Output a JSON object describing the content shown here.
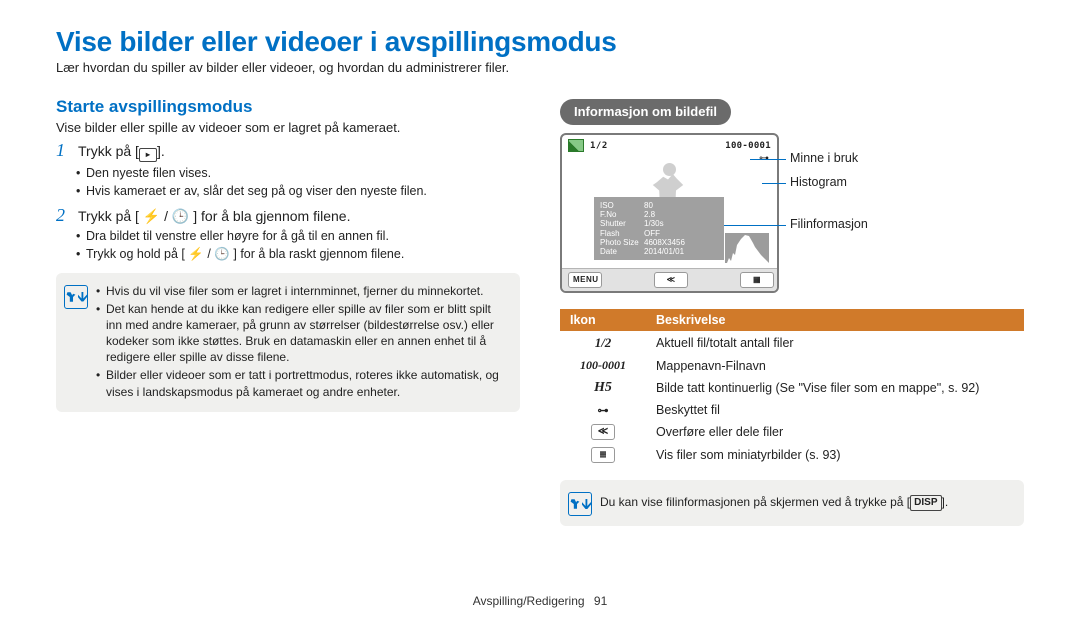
{
  "page_title": "Vise bilder eller videoer i avspillingsmodus",
  "page_lead": "Lær hvordan du spiller av bilder eller videoer, og hvordan du administrerer filer.",
  "left": {
    "section_title": "Starte avspillingsmodus",
    "section_sub": "Vise bilder eller spille av videoer som er lagret på kameraet.",
    "step1_pre": "Trykk på [",
    "step1_post": "].",
    "step1_bullets": [
      "Den nyeste filen vises.",
      "Hvis kameraet er av, slår det seg på og viser den nyeste filen."
    ],
    "step2_text": "Trykk på [ ⚡ / 🕒 ] for å bla gjennom filene.",
    "step2_bullets": [
      "Dra bildet til venstre eller høyre for å gå til en annen fil.",
      "Trykk og hold på [ ⚡ / 🕒 ] for å bla raskt gjennom filene."
    ],
    "note_items": [
      "Hvis du vil vise filer som er lagret i internminnet, fjerner du minnekortet.",
      "Det kan hende at du ikke kan redigere eller spille av filer som er blitt spilt inn med andre kameraer, på grunn av størrelser (bildestørrelse osv.) eller kodeker som ikke støttes. Bruk en datamaskin eller en annen enhet til å redigere eller spille av disse filene.",
      "Bilder eller videoer som er tatt i portrettmodus, roteres ikke automatisk, og vises i landskapsmodus på kameraet og andre enheter."
    ]
  },
  "right": {
    "pill": "Informasjon om bildefil",
    "lcd": {
      "count": "1/2",
      "file": "100-0001",
      "menu": "MENU",
      "info_labels": [
        "ISO",
        "F.No",
        "Shutter",
        "Flash",
        "Photo Size",
        "Date"
      ],
      "info_values": [
        "80",
        "2.8",
        "1/30s",
        "OFF",
        "4608X3456",
        "2014/01/01"
      ]
    },
    "callouts": [
      "Minne i bruk",
      "Histogram",
      "Filinformasjon"
    ],
    "table_head": [
      "Ikon",
      "Beskrivelse"
    ],
    "rows": [
      {
        "icon_text": "1/2",
        "desc": "Aktuell fil/totalt antall filer"
      },
      {
        "icon_text": "100-0001",
        "desc": "Mappenavn-Filnavn"
      },
      {
        "icon_text": "H5",
        "desc": "Bilde tatt kontinuerlig (Se \"Vise filer som en mappe\", s. 92)"
      },
      {
        "icon_text": "⊶",
        "desc": "Beskyttet fil"
      },
      {
        "icon_text": "share",
        "desc": "Overføre eller dele filer"
      },
      {
        "icon_text": "grid",
        "desc": "Vis filer som miniatyrbilder (s. 93)"
      }
    ],
    "tip_pre": "Du kan vise filinformasjonen på skjermen ved å trykke på [",
    "tip_key": "DISP",
    "tip_post": "]."
  },
  "footer": {
    "label": "Avspilling/Redigering",
    "page": "91"
  }
}
